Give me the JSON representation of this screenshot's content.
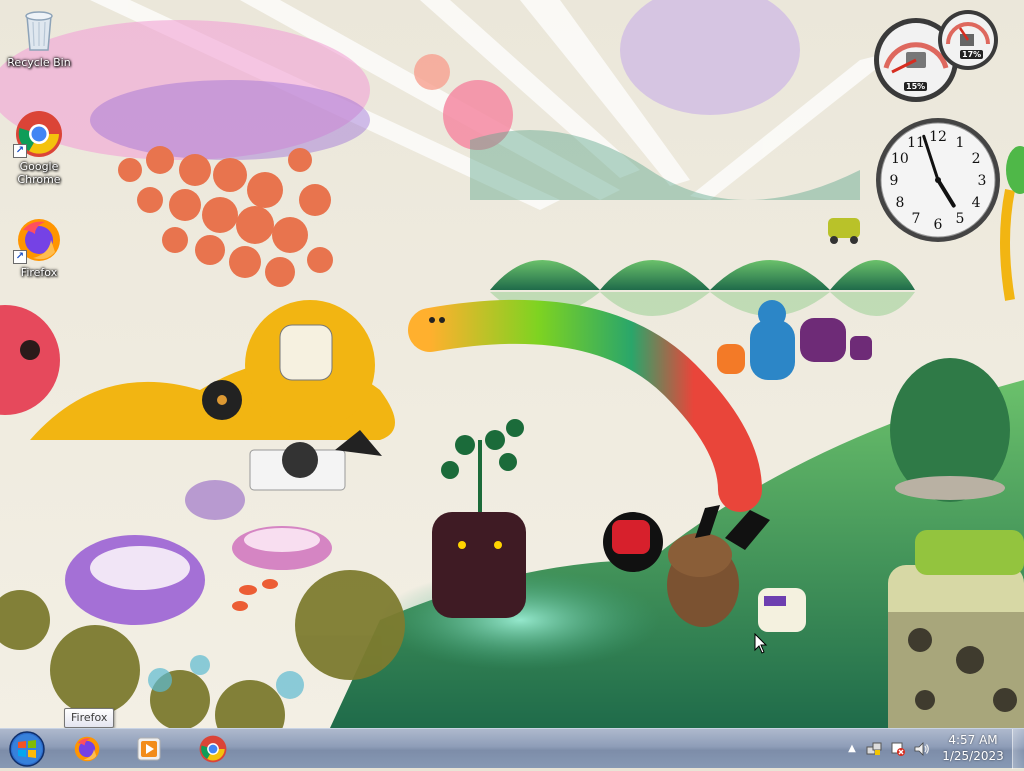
{
  "desktop": {
    "icons": [
      {
        "label": "Recycle Bin",
        "icon": "recycle-bin-icon"
      },
      {
        "label": "Google Chrome",
        "icon": "chrome-icon"
      },
      {
        "label": "Firefox",
        "icon": "firefox-icon"
      }
    ]
  },
  "gadgets": {
    "cpu_meter": {
      "cpu_percent": "15%",
      "memory_percent": "17%"
    },
    "clock": {
      "hour": 4,
      "minute": 57,
      "numerals": [
        "12",
        "1",
        "2",
        "3",
        "4",
        "5",
        "6",
        "7",
        "8",
        "9",
        "10",
        "11"
      ]
    }
  },
  "tooltip": {
    "text": "Firefox"
  },
  "taskbar": {
    "start_icon": "windows-logo-icon",
    "pinned": [
      {
        "name": "Firefox",
        "icon": "firefox-icon"
      },
      {
        "name": "Windows Media Player",
        "icon": "media-player-icon"
      },
      {
        "name": "Google Chrome",
        "icon": "chrome-icon"
      }
    ],
    "tray": {
      "icons": [
        "show-hidden-icons-arrow",
        "network-icon",
        "action-center-icon",
        "volume-icon"
      ],
      "time": "4:57 AM",
      "date": "1/25/2023"
    }
  },
  "colors": {
    "taskbar_top": "#aeb9cd",
    "taskbar_bottom": "#7d8da9",
    "wallpaper_base": "#e9e4d6"
  }
}
